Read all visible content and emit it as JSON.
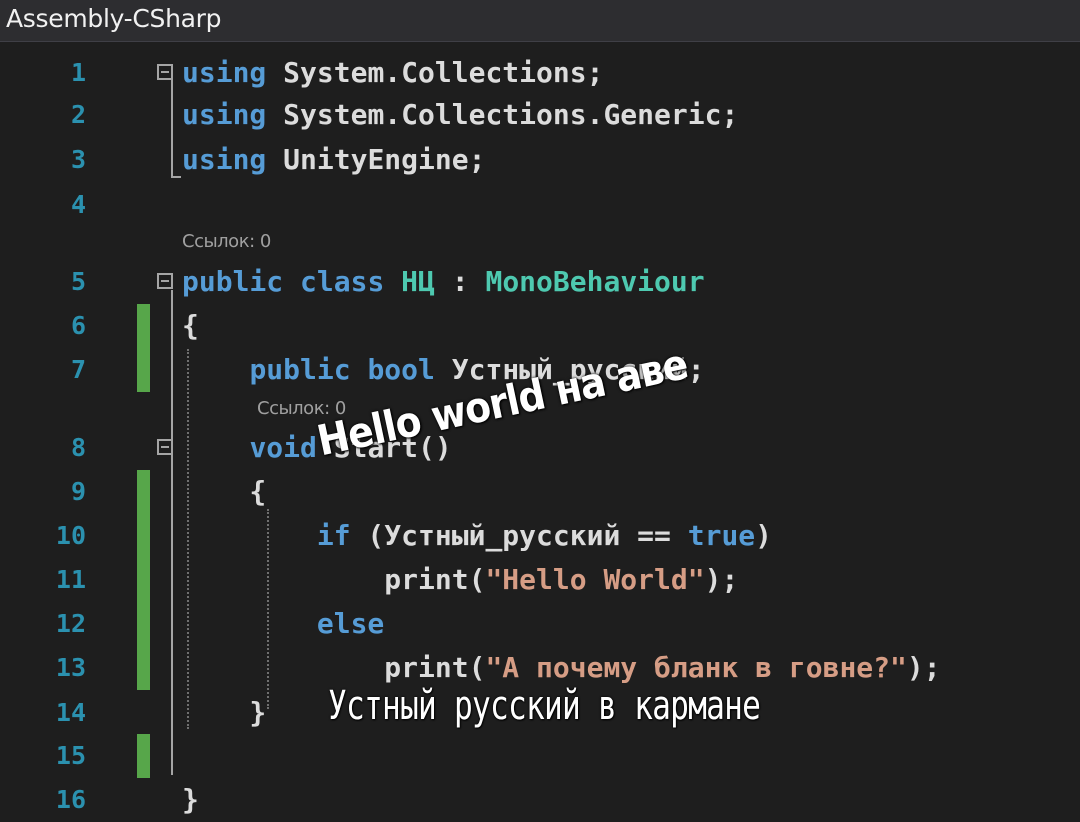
{
  "window": {
    "title": "Assembly-CSharp"
  },
  "codelens": {
    "line5": "Ссылок: 0",
    "line8": "Ссылок: 0"
  },
  "lines": [
    {
      "num": "1",
      "tokens": [
        {
          "t": "using",
          "c": "kw"
        },
        {
          "t": " System.Collections;",
          "c": "tx"
        }
      ]
    },
    {
      "num": "2",
      "tokens": [
        {
          "t": "using",
          "c": "kw"
        },
        {
          "t": " System.Collections.Generic;",
          "c": "tx"
        }
      ]
    },
    {
      "num": "3",
      "tokens": [
        {
          "t": "using",
          "c": "kw"
        },
        {
          "t": " UnityEngine;",
          "c": "tx"
        }
      ]
    },
    {
      "num": "4",
      "tokens": []
    },
    {
      "num": "5",
      "tokens": [
        {
          "t": "public",
          "c": "kw"
        },
        {
          "t": " ",
          "c": "tx"
        },
        {
          "t": "class",
          "c": "kw"
        },
        {
          "t": " ",
          "c": "tx"
        },
        {
          "t": "НЦ",
          "c": "ty"
        },
        {
          "t": " : ",
          "c": "tx"
        },
        {
          "t": "MonoBehaviour",
          "c": "ty"
        }
      ]
    },
    {
      "num": "6",
      "tokens": [
        {
          "t": "{",
          "c": "tx"
        }
      ]
    },
    {
      "num": "7",
      "tokens": [
        {
          "t": "    ",
          "c": "tx"
        },
        {
          "t": "public",
          "c": "kw"
        },
        {
          "t": " ",
          "c": "tx"
        },
        {
          "t": "bool",
          "c": "kw"
        },
        {
          "t": " Устный_русский;",
          "c": "tx"
        }
      ]
    },
    {
      "num": "8",
      "tokens": [
        {
          "t": "    ",
          "c": "tx"
        },
        {
          "t": "void",
          "c": "kw"
        },
        {
          "t": " Start()",
          "c": "tx"
        }
      ]
    },
    {
      "num": "9",
      "tokens": [
        {
          "t": "    {",
          "c": "tx"
        }
      ]
    },
    {
      "num": "10",
      "tokens": [
        {
          "t": "        ",
          "c": "tx"
        },
        {
          "t": "if",
          "c": "kw"
        },
        {
          "t": " (Устный_русский == ",
          "c": "tx"
        },
        {
          "t": "true",
          "c": "kw"
        },
        {
          "t": ")",
          "c": "tx"
        }
      ]
    },
    {
      "num": "11",
      "tokens": [
        {
          "t": "            print(",
          "c": "tx"
        },
        {
          "t": "\"Hello World\"",
          "c": "st"
        },
        {
          "t": ");",
          "c": "tx"
        }
      ]
    },
    {
      "num": "12",
      "tokens": [
        {
          "t": "        ",
          "c": "tx"
        },
        {
          "t": "else",
          "c": "kw"
        }
      ]
    },
    {
      "num": "13",
      "tokens": [
        {
          "t": "            print(",
          "c": "tx"
        },
        {
          "t": "\"А почему бланк в говне?\"",
          "c": "st"
        },
        {
          "t": ");",
          "c": "tx"
        }
      ]
    },
    {
      "num": "14",
      "tokens": [
        {
          "t": "    }",
          "c": "tx"
        }
      ]
    },
    {
      "num": "15",
      "tokens": []
    },
    {
      "num": "16",
      "tokens": [
        {
          "t": "}",
          "c": "tx"
        }
      ]
    }
  ],
  "overlays": {
    "caption_top": "Hello world на аве",
    "caption_bottom": "Устный русский в кармане"
  },
  "colors": {
    "background": "#1e1e1e",
    "line_number": "#2b91af",
    "keyword": "#569cd6",
    "type": "#4ec9b0",
    "string": "#d69d85",
    "text": "#dcdcdc",
    "change_marker": "#57a64a"
  }
}
